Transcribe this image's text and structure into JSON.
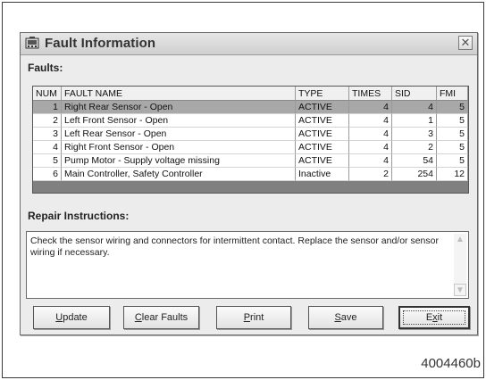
{
  "window": {
    "title": "Fault Information",
    "close_label": "✕"
  },
  "faults": {
    "label": "Faults:",
    "columns": [
      "NUM",
      "FAULT NAME",
      "TYPE",
      "TIMES",
      "SID",
      "FMI"
    ],
    "rows": [
      {
        "num": "1",
        "name": "Right Rear Sensor - Open",
        "type": "ACTIVE",
        "times": "4",
        "sid": "4",
        "fmi": "5",
        "selected": true
      },
      {
        "num": "2",
        "name": "Left Front Sensor - Open",
        "type": "ACTIVE",
        "times": "4",
        "sid": "1",
        "fmi": "5"
      },
      {
        "num": "3",
        "name": "Left Rear Sensor - Open",
        "type": "ACTIVE",
        "times": "4",
        "sid": "3",
        "fmi": "5"
      },
      {
        "num": "4",
        "name": "Right Front Sensor - Open",
        "type": "ACTIVE",
        "times": "4",
        "sid": "2",
        "fmi": "5"
      },
      {
        "num": "5",
        "name": "Pump Motor - Supply voltage missing",
        "type": "ACTIVE",
        "times": "4",
        "sid": "54",
        "fmi": "5"
      },
      {
        "num": "6",
        "name": "Main Controller, Safety Controller",
        "type": "Inactive",
        "times": "2",
        "sid": "254",
        "fmi": "12"
      }
    ]
  },
  "repair": {
    "label": "Repair Instructions:",
    "text": "Check the sensor wiring and connectors for intermittent contact.  Replace the sensor and/or sensor wiring if necessary."
  },
  "buttons": {
    "update": {
      "first": "U",
      "rest": "pdate"
    },
    "clear": {
      "first": "C",
      "rest": "lear Faults"
    },
    "print": {
      "first": "P",
      "rest": "rint"
    },
    "save": {
      "first": "S",
      "rest": "ave"
    },
    "exit": {
      "first": "E",
      "mid": "x",
      "rest": "it"
    }
  },
  "image_code": "4004460b"
}
